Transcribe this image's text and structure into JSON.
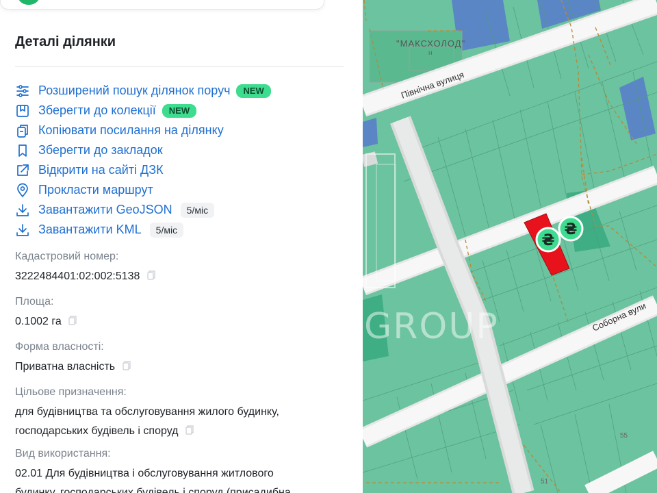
{
  "panel": {
    "title": "Деталі ділянки",
    "actions": [
      {
        "label": "Розширений пошук ділянок поруч",
        "icon": "sliders-icon",
        "badge": "NEW"
      },
      {
        "label": "Зберегти до колекції",
        "icon": "collection-icon",
        "badge": "NEW"
      },
      {
        "label": "Копіювати посилання на ділянку",
        "icon": "copy-link-icon"
      },
      {
        "label": "Зберегти до закладок",
        "icon": "bookmark-icon"
      },
      {
        "label": "Відкрити на сайті ДЗК",
        "icon": "external-link-icon"
      },
      {
        "label": "Прокласти маршрут",
        "icon": "location-pin-icon"
      },
      {
        "label": "Завантажити GeoJSON",
        "icon": "download-icon",
        "limit": "5/міс"
      },
      {
        "label": "Завантажити KML",
        "icon": "download-icon",
        "limit": "5/міс"
      }
    ],
    "fields": {
      "cadastral": {
        "label": "Кадастровий номер:",
        "value": "3222484401:02:002:5138"
      },
      "area": {
        "label": "Площа:",
        "value": "0.1002 га"
      },
      "ownership": {
        "label": "Форма власності:",
        "value": "Приватна власність"
      },
      "purpose": {
        "label": "Цільове призначення:",
        "value_line1": "для будівництва та обслуговування жилого будинку,",
        "value_line2": "господарських будівель і споруд"
      },
      "usage": {
        "label": "Вид використання:",
        "value_line1": "02.01 Для будівництва і обслуговування житлового",
        "value_line2": "будинку, господарських будівель і споруд (присадибна"
      }
    }
  },
  "map": {
    "streets": {
      "north": "Північна вулиця",
      "cathedral": "Соборна вули"
    },
    "poi": {
      "label": "\"МАКСХОЛОД\"",
      "sub": "н"
    },
    "watermark": "GROUP",
    "price_marker": "₴",
    "house_numbers": [
      "55",
      "51"
    ],
    "colors": {
      "parcel": "#6cc39f",
      "parcel_dark": "#3fae84",
      "selected": "#e8121c",
      "state": "#5b86c5",
      "road": "#f5f5f5",
      "boundary": "#b48a3a"
    }
  },
  "colors": {
    "link": "#1f6fd1",
    "badge_new_bg": "#3ddc8f",
    "muted_label": "#7a828c"
  }
}
